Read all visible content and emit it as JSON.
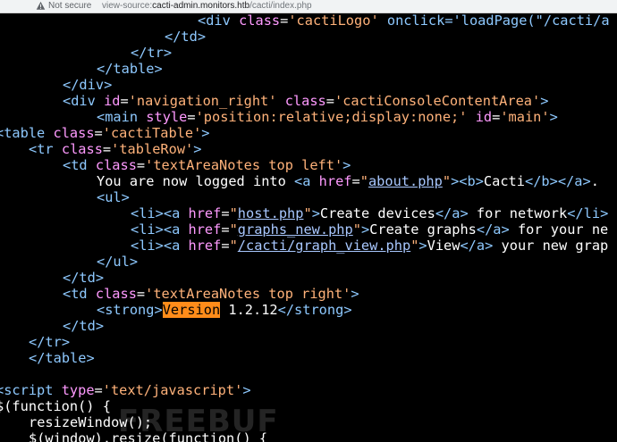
{
  "browser": {
    "security_label": "Not secure",
    "url_scheme": "view-source:",
    "url_host": "cacti-admin.monitors.htb",
    "url_path": "/cacti/index.php"
  },
  "code_lines": [
    "<div class='cactiLogo' onclick='loadPage(\"/cacti/a",
    "</td>",
    "</tr>",
    "</table>",
    "</div>",
    "<div id='navigation_right' class='cactiConsoleContentArea'>",
    "<main style='position:relative;display:none;' id='main'>",
    "<table class='cactiTable'>",
    "<tr class='tableRow'>",
    "<td class='textAreaNotes top left'>",
    "You are now logged into <a href=\"about.php\"><b>Cacti</b></a>.",
    "<ul>",
    "<li><a href=\"host.php\">Create devices</a> for network</li>",
    "<li><a href=\"graphs_new.php\">Create graphs</a> for your ne",
    "<li><a href=\"/cacti/graph_view.php\">View</a> your new grap",
    "</ul>",
    "</td>",
    "<td class='textAreaNotes top right'>",
    "<strong>Version 1.2.12</strong>",
    "</td>",
    "</tr>",
    "</table>",
    "",
    "<script type='text/javascript'>",
    "$(function() {",
    "resizeWindow();",
    "$(window).resize(function() {"
  ],
  "highlighted_text": "Version",
  "watermark_text": "FREEBUF"
}
